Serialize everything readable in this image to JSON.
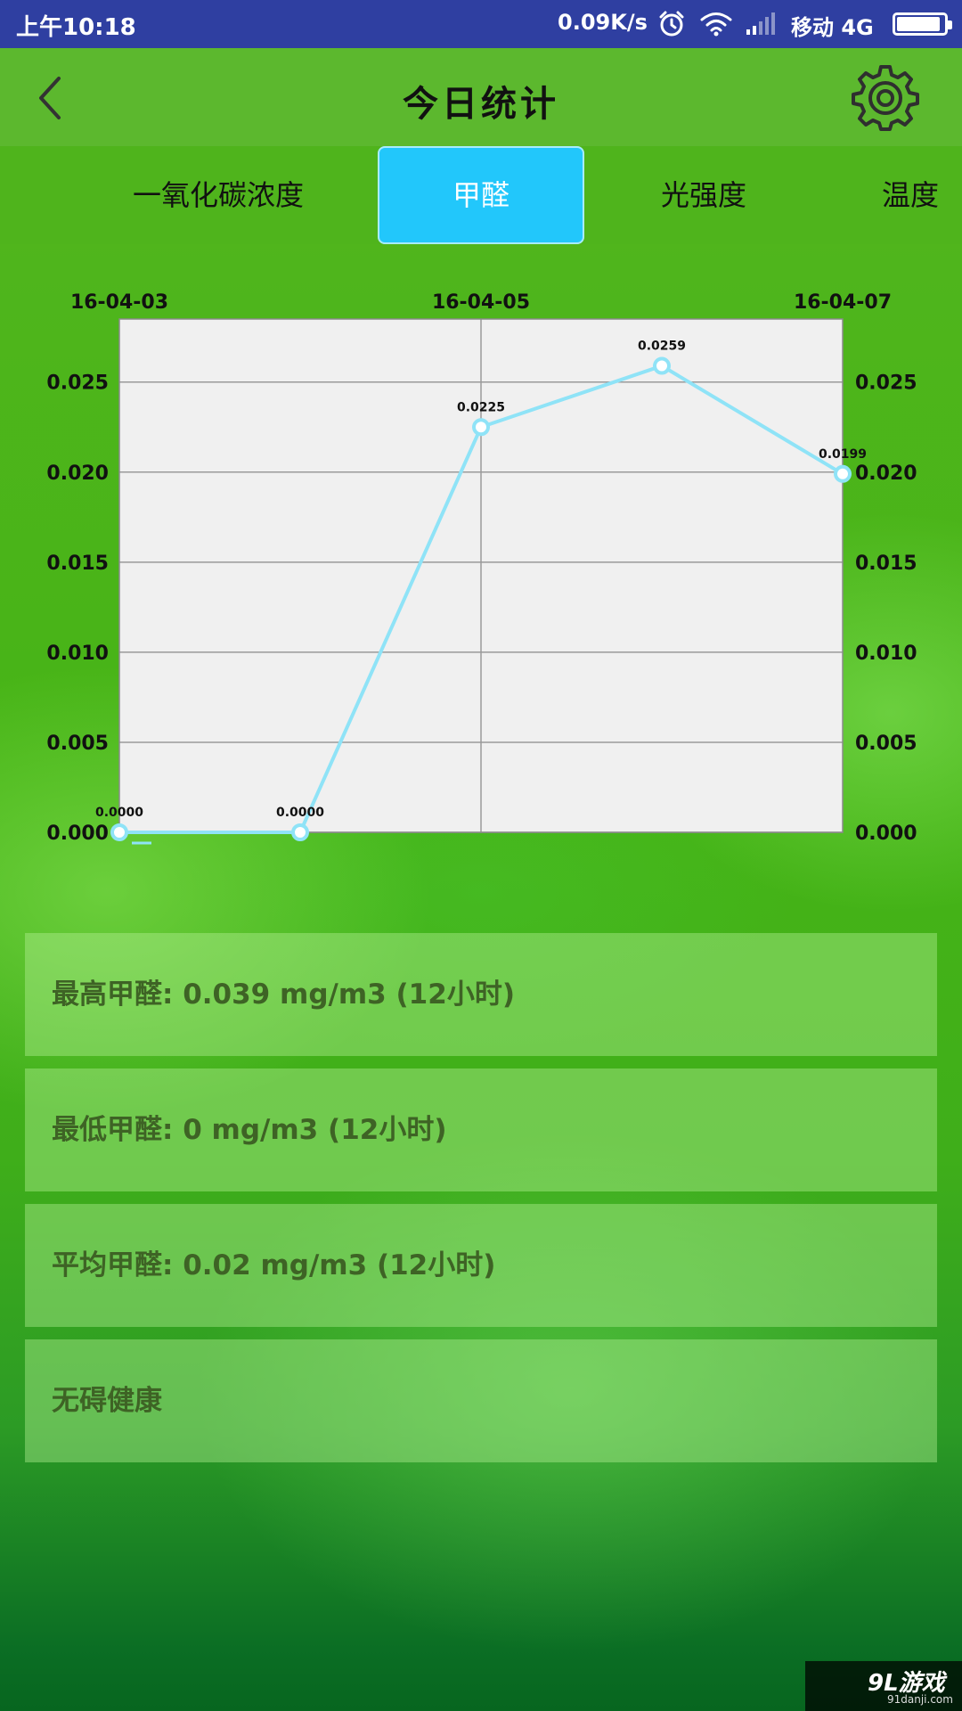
{
  "status_bar": {
    "time": "上午10:18",
    "network_speed": "0.09K/s",
    "carrier": "移动 4G",
    "battery_percent": 92
  },
  "header": {
    "title": "今日统计",
    "back_icon": "chevron-left-icon",
    "settings_icon": "gear-icon"
  },
  "tabs": [
    {
      "label": "一氧化碳浓度",
      "active": false
    },
    {
      "label": "甲醛",
      "active": true
    },
    {
      "label": "光强度",
      "active": false
    },
    {
      "label": "温度",
      "active": false
    }
  ],
  "chart_data": {
    "type": "line",
    "x": [
      "16-04-03",
      "16-04-04",
      "16-04-05",
      "16-04-06",
      "16-04-07"
    ],
    "x_tick_labels": [
      "16-04-03",
      "16-04-05",
      "16-04-07"
    ],
    "values": [
      0.0,
      0.0,
      0.0225,
      0.0259,
      0.0199
    ],
    "point_labels": [
      "0.0000",
      "0.0000",
      "0.0225",
      "0.0259",
      "0.0199"
    ],
    "y_ticks": [
      "0.000",
      "0.005",
      "0.010",
      "0.015",
      "0.020",
      "0.025"
    ],
    "ylim": [
      0,
      0.0285
    ],
    "grid": true,
    "line_color": "#8fe3f7",
    "plot_bg": "#f0f0f0"
  },
  "stats": [
    {
      "text": "最高甲醛: 0.039 mg/m3 (12小时)"
    },
    {
      "text": "最低甲醛: 0 mg/m3 (12小时)"
    },
    {
      "text": "平均甲醛: 0.02 mg/m3 (12小时)"
    },
    {
      "text": "无碍健康"
    }
  ],
  "watermark": {
    "logo": "9L游戏",
    "url": "91danji.com"
  },
  "colors": {
    "statusbar": "#2f3fa1",
    "appbar": "#5cb82e",
    "active_tab": "#22c7fb",
    "stat_text": "#3e6325"
  }
}
